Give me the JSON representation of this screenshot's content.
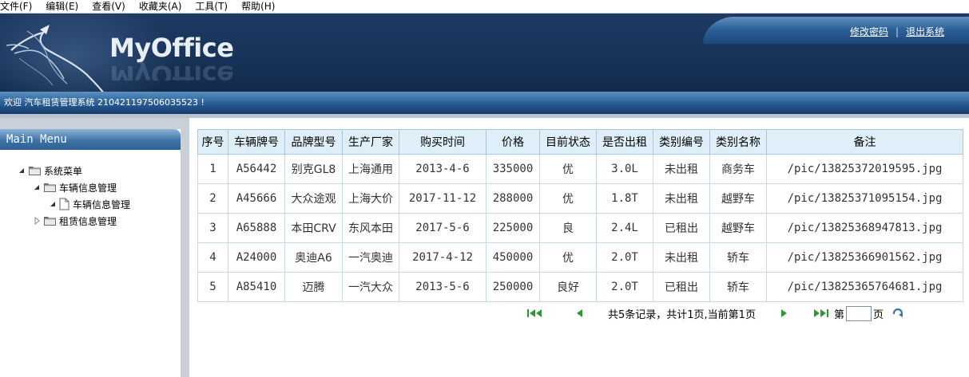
{
  "menubar": [
    "文件(F)",
    "编辑(E)",
    "查看(V)",
    "收藏夹(A)",
    "工具(T)",
    "帮助(H)"
  ],
  "header": {
    "logo": "MyOffice",
    "change_password": "修改密码",
    "separator": "|",
    "logout": "退出系统"
  },
  "welcome": "欢迎 汽车租赁管理系统 210421197506035523 !",
  "sidebar": {
    "title": "Main Menu",
    "tree": {
      "root": "系统菜单",
      "vehicle_group": "车辆信息管理",
      "vehicle_leaf": "车辆信息管理",
      "rental_group": "租赁信息管理"
    }
  },
  "table": {
    "columns": [
      "序号",
      "车辆牌号",
      "品牌型号",
      "生产厂家",
      "购买时间",
      "价格",
      "目前状态",
      "是否出租",
      "类别编号",
      "类别名称",
      "备注"
    ],
    "rows": [
      [
        "1",
        "A56442",
        "别克GL8",
        "上海通用",
        "2013-4-6",
        "335000",
        "优",
        "3.0L",
        "未出租",
        "商务车",
        "/pic/13825372019595.jpg"
      ],
      [
        "2",
        "A45666",
        "大众途观",
        "上海大价",
        "2017-11-12",
        "288000",
        "优",
        "1.8T",
        "未出租",
        "越野车",
        "/pic/13825371095154.jpg"
      ],
      [
        "3",
        "A65888",
        "本田CRV",
        "东风本田",
        "2017-5-6",
        "225000",
        "良",
        "2.4L",
        "已租出",
        "越野车",
        "/pic/13825368947813.jpg"
      ],
      [
        "4",
        "A24000",
        "奥迪A6",
        "一汽奥迪",
        "2017-4-12",
        "450000",
        "优",
        "2.0T",
        "未出租",
        "轿车",
        "/pic/13825366901562.jpg"
      ],
      [
        "5",
        "A85410",
        "迈腾",
        "一汽大众",
        "2013-5-6",
        "250000",
        "良好",
        "2.0T",
        "已租出",
        "轿车",
        "/pic/13825365764681.jpg"
      ]
    ]
  },
  "pager": {
    "summary": "共5条记录，共计1页,当前第1页",
    "page_prefix": "第",
    "page_suffix": "页",
    "page_input": ""
  },
  "colors": {
    "header_bg": "#173257",
    "table_header_bg": "#deeffa",
    "table_border": "#a9c8dc",
    "pager_green": "#2c9a33"
  },
  "icons": [
    "first-page-icon",
    "prev-page-icon",
    "next-page-icon",
    "last-page-icon",
    "go-refresh-icon",
    "folder-icon",
    "document-icon",
    "expand-triangle-icon",
    "collapse-triangle-icon"
  ]
}
